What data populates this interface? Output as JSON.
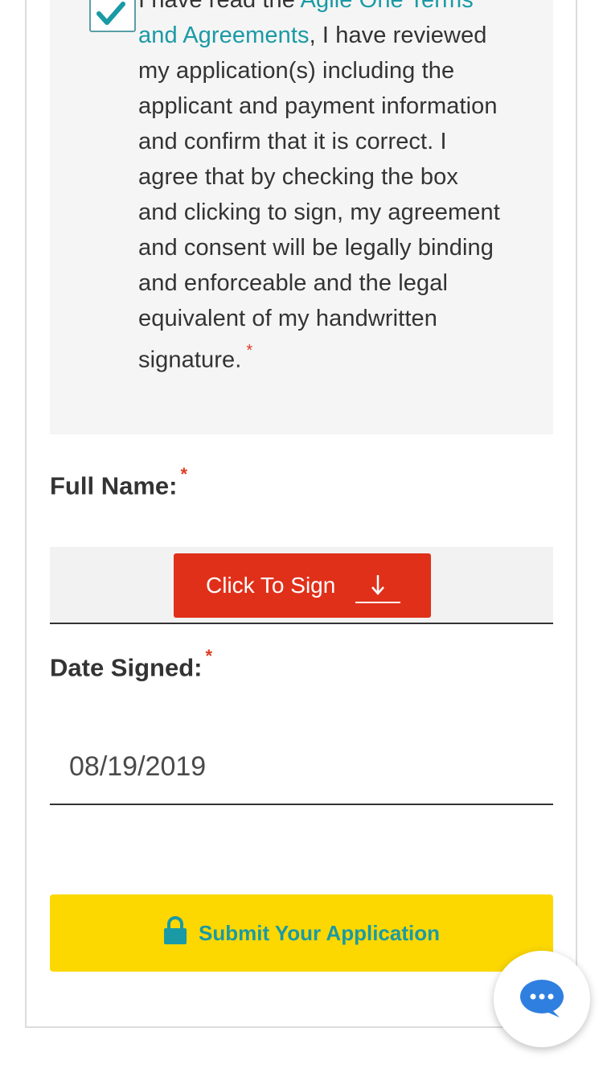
{
  "agreement": {
    "checked": true,
    "text_prefix": "I have read the ",
    "link_text": "Agile One Terms and Agreements",
    "text_suffix": ", I have reviewed my application(s) including the applicant and payment information and confirm that it is correct. I agree that by checking the box and clicking to sign, my agreement and consent will be legally binding and enforceable and the legal equivalent of my handwritten signature.",
    "required_marker": "*"
  },
  "full_name": {
    "label": "Full Name:",
    "required_marker": "*",
    "sign_button_label": "Click To Sign",
    "sign_icon": "arrow-down-icon"
  },
  "date_signed": {
    "label": "Date Signed:",
    "required_marker": "*",
    "value": "08/19/2019"
  },
  "submit": {
    "label": "Submit Your Application",
    "icon": "lock-icon"
  },
  "chat": {
    "icon": "chat-bubble-icon"
  },
  "colors": {
    "link": "#1a9aa5",
    "required": "#e03a22",
    "sign_button": "#e0301a",
    "submit_button": "#fcd800",
    "chat_icon": "#2f7fe0"
  }
}
